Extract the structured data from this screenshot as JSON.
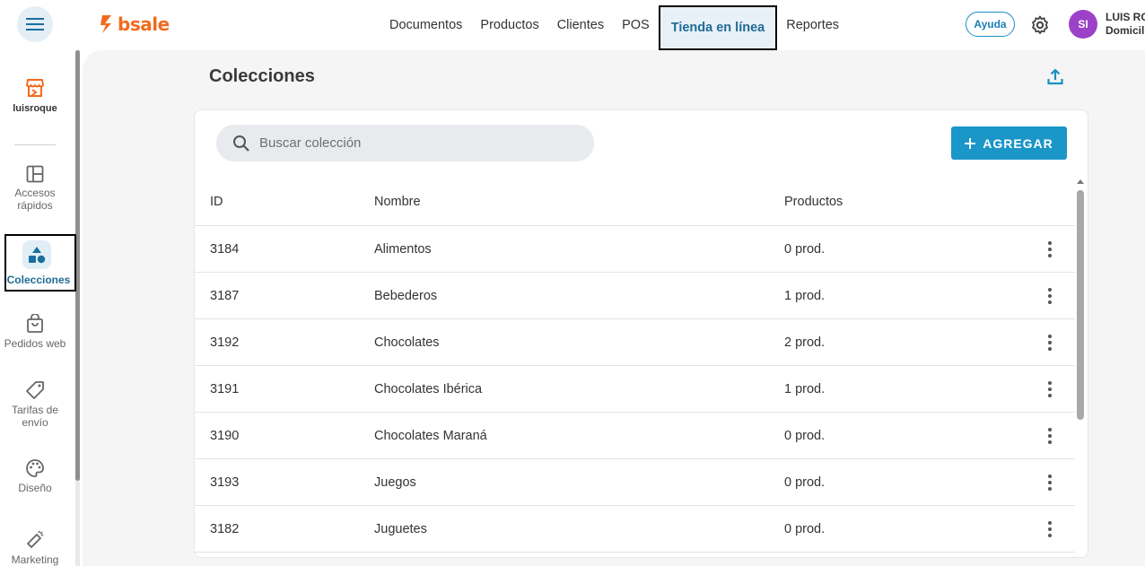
{
  "header": {
    "logo_text": "bsale",
    "nav": [
      "Documentos",
      "Productos",
      "Clientes",
      "POS",
      "Tienda en línea",
      "Reportes"
    ],
    "active_nav": "Tienda en línea",
    "help_label": "Ayuda",
    "avatar_initials": "SI",
    "user_name": "LUIS RO",
    "user_sub": "Domicil"
  },
  "sidebar": {
    "store_name": "luisroque",
    "items": [
      {
        "label": "Accesos rápidos",
        "icon": "layout-icon"
      },
      {
        "label": "Colecciones",
        "icon": "shapes-icon",
        "active": true
      },
      {
        "label": "Pedidos web",
        "icon": "shopping-bag-icon"
      },
      {
        "label": "Tarifas de envío",
        "icon": "tag-icon"
      },
      {
        "label": "Diseño",
        "icon": "palette-icon"
      },
      {
        "label": "Marketing",
        "icon": "megaphone-icon"
      }
    ]
  },
  "main": {
    "title": "Colecciones",
    "search_placeholder": "Buscar colección",
    "add_label": "AGREGAR",
    "columns": [
      "ID",
      "Nombre",
      "Productos"
    ],
    "rows": [
      {
        "id": "3184",
        "name": "Alimentos",
        "products": "0 prod."
      },
      {
        "id": "3187",
        "name": "Bebederos",
        "products": "1 prod."
      },
      {
        "id": "3192",
        "name": "Chocolates",
        "products": "2 prod."
      },
      {
        "id": "3191",
        "name": "Chocolates Ibérica",
        "products": "1 prod."
      },
      {
        "id": "3190",
        "name": "Chocolates Maraná",
        "products": "0 prod."
      },
      {
        "id": "3193",
        "name": "Juegos",
        "products": "0 prod."
      },
      {
        "id": "3182",
        "name": "Juguetes",
        "products": "0 prod."
      }
    ]
  },
  "colors": {
    "accent": "#1a96c9",
    "brand": "#f26b1d",
    "avatar": "#9c42c9"
  }
}
